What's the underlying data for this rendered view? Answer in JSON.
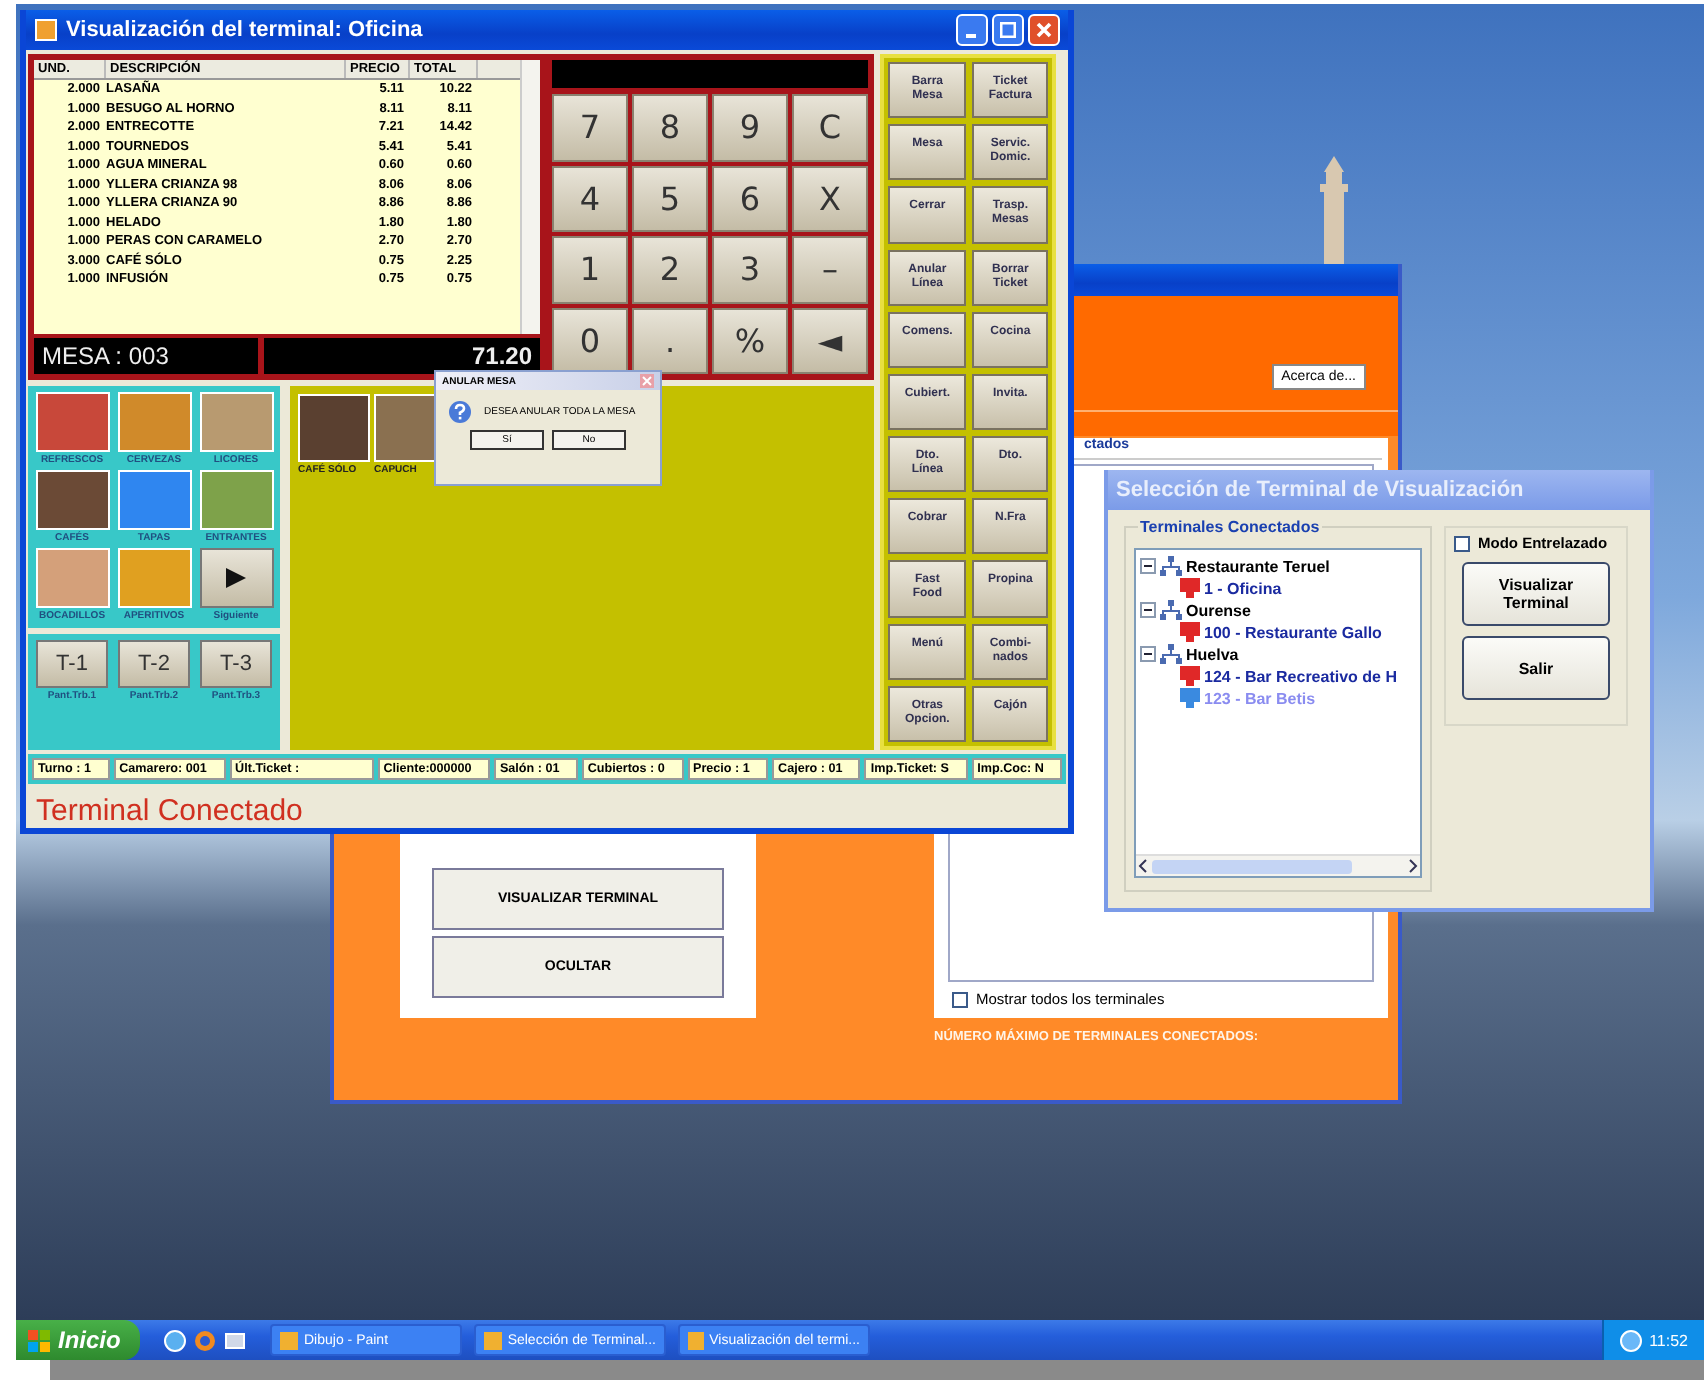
{
  "main_window": {
    "title": "Visualización del terminal: Oficina",
    "ticket": {
      "columns": [
        "UND.",
        "DESCRIPCIÓN",
        "PRECIO",
        "TOTAL"
      ],
      "rows": [
        {
          "qty": "2.000",
          "description": "LASAÑA",
          "price": "5.11",
          "total": "10.22"
        },
        {
          "qty": "1.000",
          "description": "BESUGO AL HORNO",
          "price": "8.11",
          "total": "8.11"
        },
        {
          "qty": "2.000",
          "description": "ENTRECOTTE",
          "price": "7.21",
          "total": "14.42"
        },
        {
          "qty": "1.000",
          "description": "TOURNEDOS",
          "price": "5.41",
          "total": "5.41"
        },
        {
          "qty": "1.000",
          "description": "AGUA MINERAL",
          "price": "0.60",
          "total": "0.60"
        },
        {
          "qty": "1.000",
          "description": "YLLERA CRIANZA 98",
          "price": "8.06",
          "total": "8.06"
        },
        {
          "qty": "1.000",
          "description": "YLLERA CRIANZA 90",
          "price": "8.86",
          "total": "8.86"
        },
        {
          "qty": "1.000",
          "description": "HELADO",
          "price": "1.80",
          "total": "1.80"
        },
        {
          "qty": "1.000",
          "description": "PERAS CON CARAMELO",
          "price": "2.70",
          "total": "2.70"
        },
        {
          "qty": "3.000",
          "description": "CAFÉ SÓLO",
          "price": "0.75",
          "total": "2.25"
        },
        {
          "qty": "1.000",
          "description": "INFUSIÓN",
          "price": "0.75",
          "total": "0.75"
        }
      ]
    },
    "table_label": "MESA : 003",
    "total": "71.20",
    "keypad": [
      "7",
      "8",
      "9",
      "C",
      "4",
      "5",
      "6",
      "X",
      "1",
      "2",
      "3",
      "–",
      "0",
      ".",
      "%",
      "◄"
    ],
    "function_buttons": [
      "Barra Mesa",
      "Ticket Factura",
      "Mesa",
      "Servic. Domic.",
      "Cerrar",
      "Trasp. Mesas",
      "Anular Línea",
      "Borrar Ticket",
      "Comens.",
      "Cocina",
      "Cubiert.",
      "Invita.",
      "Dto. Línea",
      "Dto.",
      "Cobrar",
      "N.Fra",
      "Fast Food",
      "Propina",
      "Menú",
      "Combi-nados",
      "Otras Opcion.",
      "Cajón"
    ],
    "categories": [
      {
        "label": "REFRESCOS",
        "kind": "photo"
      },
      {
        "label": "CERVEZAS",
        "kind": "photo"
      },
      {
        "label": "LICORES",
        "kind": "photo"
      },
      {
        "label": "CAFÉS",
        "kind": "photo"
      },
      {
        "label": "TAPAS",
        "kind": "photo"
      },
      {
        "label": "ENTRANTES",
        "kind": "photo"
      },
      {
        "label": "BOCADILLOS",
        "kind": "photo"
      },
      {
        "label": "APERITIVOS",
        "kind": "photo"
      },
      {
        "label": "Siguiente",
        "kind": "arrow"
      }
    ],
    "terminals": [
      {
        "button": "T-1",
        "label": "Pant.Trb.1"
      },
      {
        "button": "T-2",
        "label": "Pant.Trb.2"
      },
      {
        "button": "T-3",
        "label": "Pant.Trb.3"
      }
    ],
    "products": [
      {
        "label": "CAFÉ SÓLO"
      },
      {
        "label": "CAPUCH"
      }
    ],
    "status_fields": [
      "Turno : 1",
      "Camarero: 001",
      "Últ.Ticket :",
      "Cliente:000000",
      "Salón : 01",
      "Cubiertos : 0",
      "Precio : 1",
      "Cajero : 01",
      "Imp.Ticket: S",
      "Imp.Coc: N"
    ],
    "connection_status": "Terminal Conectado"
  },
  "confirm_dialog": {
    "title": "ANULAR MESA",
    "message": "DESEA ANULAR TODA LA MESA",
    "buttons": [
      "Sí",
      "No"
    ]
  },
  "background_window": {
    "about_button": "Acerca de...",
    "list_heading": "ctados",
    "buttons": [
      "VISUALIZAR TERMINAL",
      "OCULTAR"
    ],
    "show_all": {
      "label": "Mostrar todos los terminales",
      "checked": false
    },
    "max_terminals_label": "NÚMERO MÁXIMO DE TERMINALES CONECTADOS:"
  },
  "selection_dialog": {
    "title": "Selección de Terminal de Visualización",
    "group_title": "Terminales Conectados",
    "tree": [
      {
        "label": "Restaurante Teruel",
        "expanded": true,
        "children": [
          {
            "label": "1 - Oficina",
            "kind": "online"
          }
        ]
      },
      {
        "label": "Ourense",
        "expanded": true,
        "children": [
          {
            "label": "100 - Restaurante Gallo",
            "kind": "online"
          }
        ]
      },
      {
        "label": "Huelva",
        "expanded": true,
        "children": [
          {
            "label": "124 - Bar Recreativo de H",
            "kind": "online"
          },
          {
            "label": "123 - Bar Betis",
            "kind": "offline"
          }
        ]
      }
    ],
    "interlaced": {
      "label": "Modo Entrelazado",
      "checked": false
    },
    "buttons": [
      "Visualizar Terminal",
      "Salir"
    ]
  },
  "taskbar": {
    "start": "Inicio",
    "tasks": [
      "Dibujo - Paint",
      "Selección de Terminal...",
      "Visualización del termi..."
    ],
    "clock": "11:52"
  }
}
